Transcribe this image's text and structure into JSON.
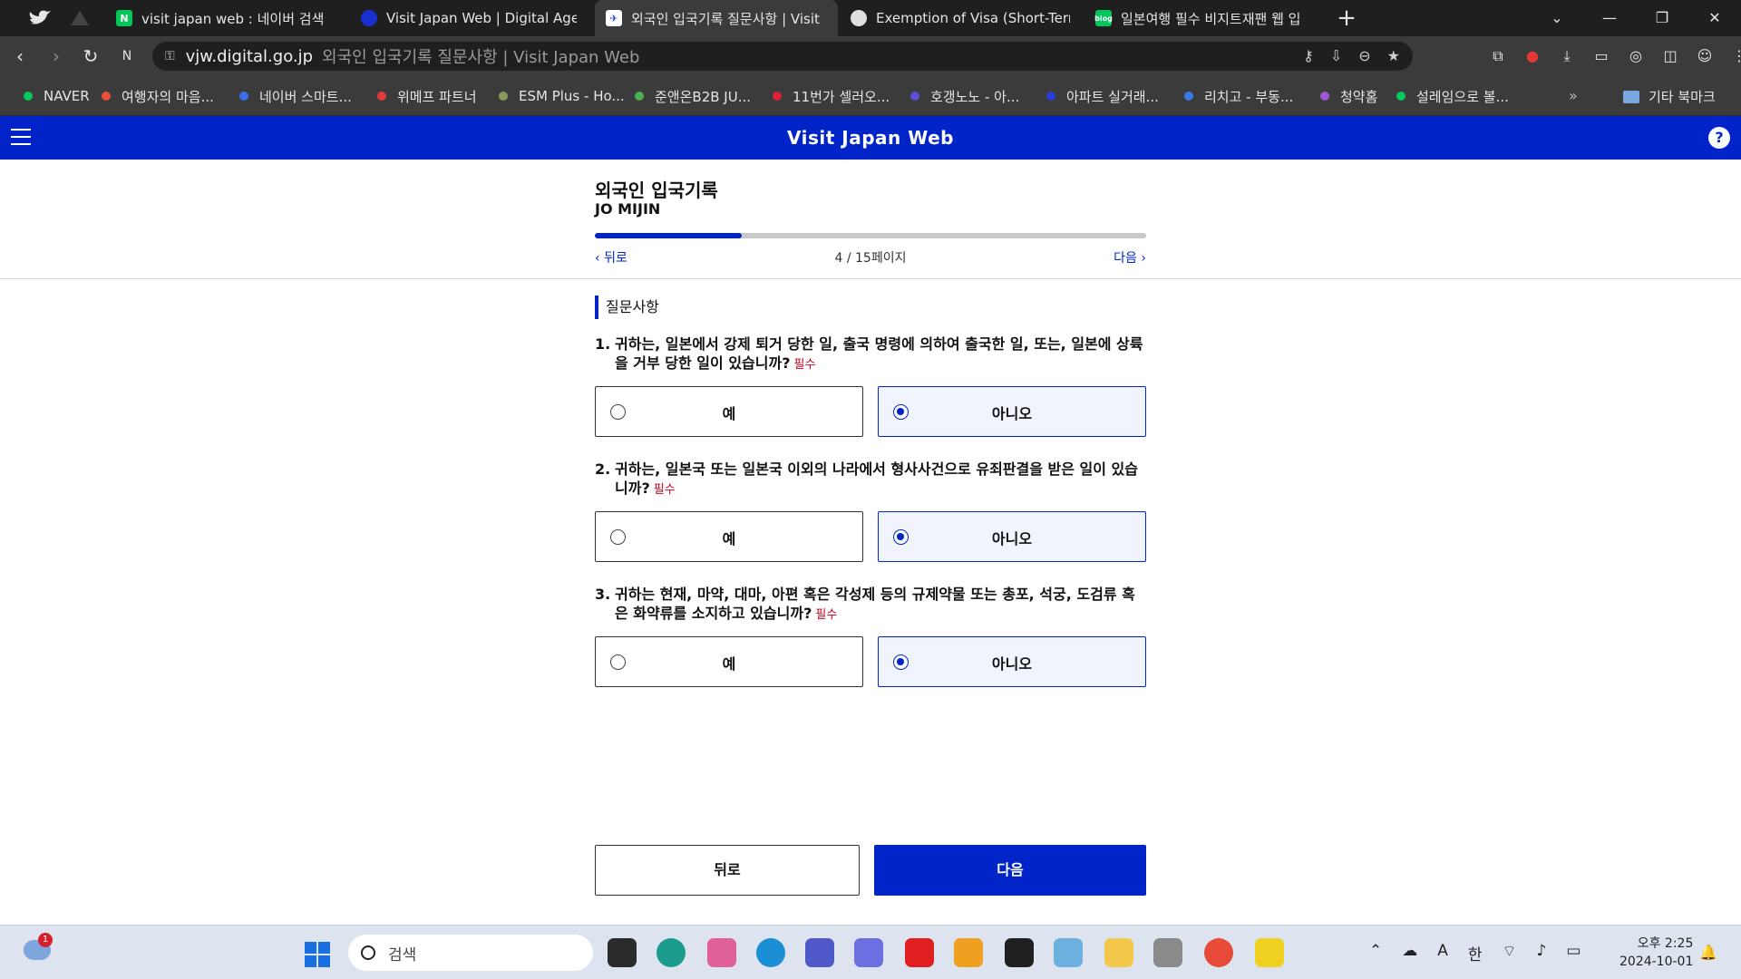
{
  "browser": {
    "tabs": [
      {
        "title": "visit japan web : 네이버 검색",
        "favicon": "naver-icon",
        "color": "#03c75a",
        "active": false
      },
      {
        "title": "Visit Japan Web | Digital Agency",
        "favicon": "digital-agency-icon",
        "color": "#1a2fcf",
        "active": false
      },
      {
        "title": "외국인 입국기록 질문사항 | Visit",
        "favicon": "visit-japan-web-icon",
        "color": "#2049c9",
        "active": true
      },
      {
        "title": "Exemption of Visa (Short-Term S",
        "favicon": "mofa-icon",
        "color": "#e0e0e0",
        "active": false
      },
      {
        "title": "일본여행 필수 비지트재팬 웹 입",
        "favicon": "blog-icon",
        "color": "#03c75a",
        "active": false
      }
    ],
    "url_domain": "vjw.digital.go.jp",
    "url_title": "외국인 입국기록 질문사항 | Visit Japan Web",
    "bookmarks": [
      {
        "label": "NAVER",
        "color": "#03c75a"
      },
      {
        "label": "여행자의 마음...",
        "color": "#e8503a"
      },
      {
        "label": "네이버 스마트...",
        "color": "#3a6ee8"
      },
      {
        "label": "위메프 파트너",
        "color": "#e03a3a"
      },
      {
        "label": "ESM Plus - Ho...",
        "color": "#8a9a5b"
      },
      {
        "label": "준앤온B2B JU...",
        "color": "#4caf50"
      },
      {
        "label": "11번가 셀러오...",
        "color": "#e0203a"
      },
      {
        "label": "호갱노노 - 아...",
        "color": "#5a4fd6"
      },
      {
        "label": "아파트 실거래...",
        "color": "#2a3fd6"
      },
      {
        "label": "리치고 - 부동...",
        "color": "#3a7ae8"
      },
      {
        "label": "청약홈",
        "color": "#9a5ad6"
      },
      {
        "label": "설레임으로 볼...",
        "color": "#03c75a"
      }
    ],
    "bookmark_folder": "기타 북마크"
  },
  "app": {
    "title": "Visit Japan Web",
    "help": "?"
  },
  "form": {
    "title": "외국인 입국기록",
    "name": "JO MIJIN",
    "progress": {
      "current": 4,
      "total": 15,
      "fraction": 0.267
    },
    "page_label": "4 / 15페이지",
    "prev_label": "뒤로",
    "next_label": "다음",
    "section": "질문사항",
    "required_label": "필수",
    "questions": [
      {
        "number": "1.",
        "text": "귀하는, 일본에서 강제 퇴거 당한 일, 출국 명령에 의하여 출국한 일, 또는, 일본에 상륙을 거부 당한 일이 있습니까?",
        "options": [
          "예",
          "아니오"
        ],
        "selected": "아니오"
      },
      {
        "number": "2.",
        "text": "귀하는, 일본국 또는 일본국 이외의 나라에서 형사사건으로 유죄판결을 받은 일이 있습니까?",
        "options": [
          "예",
          "아니오"
        ],
        "selected": "아니오"
      },
      {
        "number": "3.",
        "text": "귀하는 현재, 마약, 대마, 아편 혹은 각성제 등의 규제약물 또는 총포, 석궁, 도검류 혹은 화약류를 소지하고 있습니까?",
        "options": [
          "예",
          "아니오"
        ],
        "selected": "아니오"
      }
    ],
    "back_button": "뒤로",
    "next_button": "다음"
  },
  "taskbar": {
    "search_placeholder": "검색",
    "notification_count": "1",
    "ime_lang": "한",
    "ime_mode": "A",
    "time": "오후 2:25",
    "date": "2024-10-01"
  },
  "colors": {
    "brand_blue": "#0024c7",
    "required_red": "#d4001a"
  }
}
